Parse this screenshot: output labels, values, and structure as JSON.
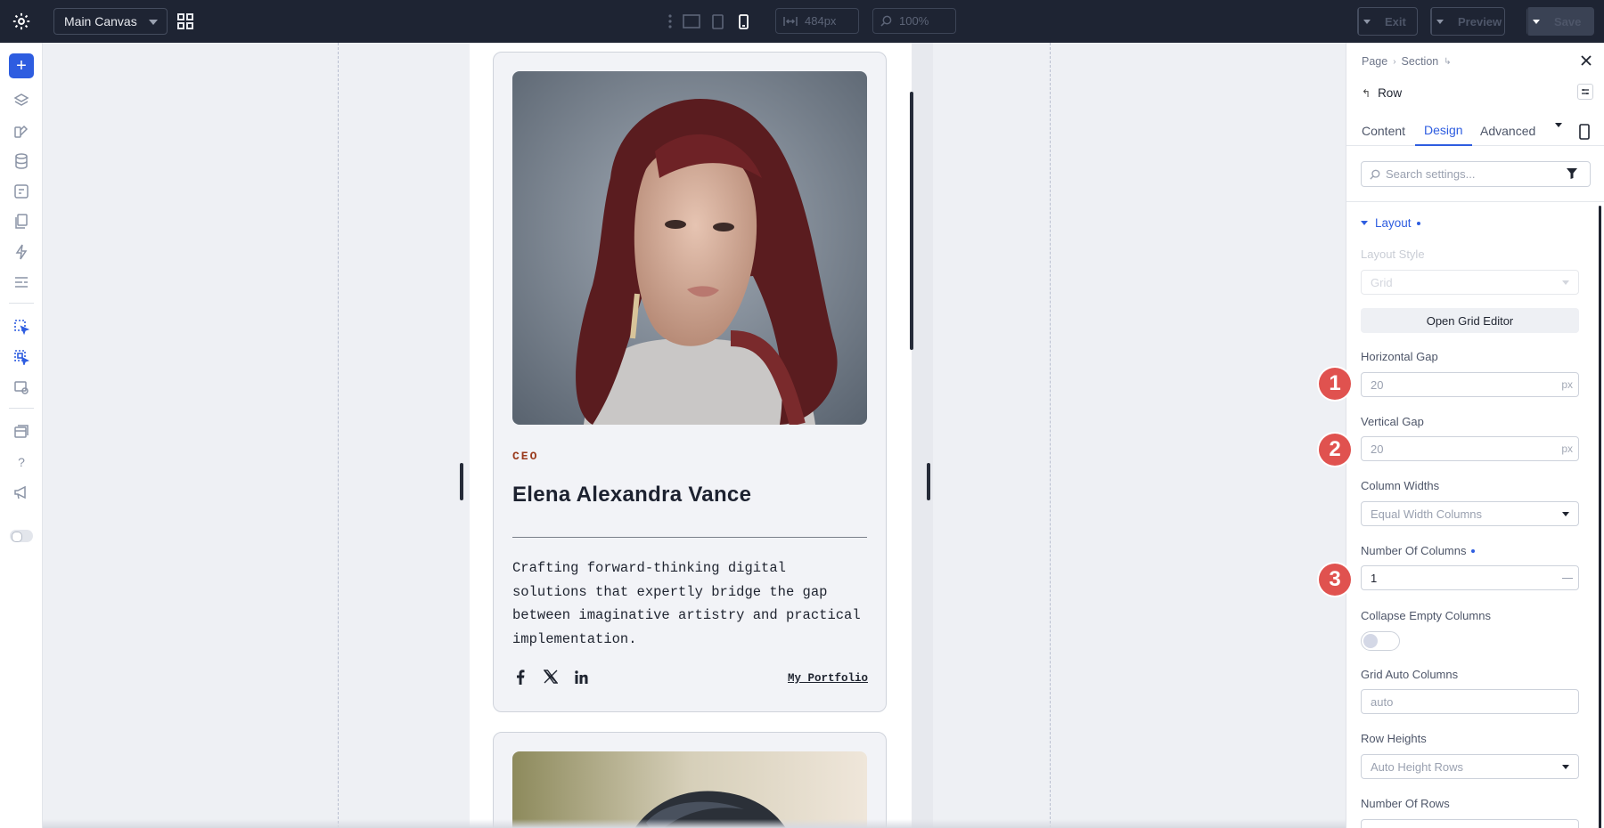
{
  "topbar": {
    "canvas_select": "Main Canvas",
    "width_value": "484px",
    "zoom_value": "100%",
    "exit_label": "Exit",
    "preview_label": "Preview",
    "save_label": "Save"
  },
  "card": {
    "role": "CEO",
    "name": "Elena Alexandra Vance",
    "bio": "Crafting forward-thinking digital solutions that expertly bridge the gap between imaginative artistry and practical implementation.",
    "portfolio_link": "My Portfolio"
  },
  "panel": {
    "breadcrumb": [
      "Page",
      "Section"
    ],
    "element_title": "Row",
    "tabs": [
      "Content",
      "Design",
      "Advanced"
    ],
    "active_tab": "Design",
    "search_placeholder": "Search settings...",
    "section_title": "Layout",
    "layout_style_label": "Layout Style",
    "layout_style_value": "Grid",
    "grid_editor_button": "Open Grid Editor",
    "horizontal_gap_label": "Horizontal Gap",
    "horizontal_gap_placeholder": "20",
    "vertical_gap_label": "Vertical Gap",
    "vertical_gap_placeholder": "20",
    "unit": "px",
    "column_widths_label": "Column Widths",
    "column_widths_value": "Equal Width Columns",
    "number_columns_label": "Number Of Columns",
    "number_columns_value": "1",
    "collapse_label": "Collapse Empty Columns",
    "grid_auto_columns_label": "Grid Auto Columns",
    "grid_auto_columns_placeholder": "auto",
    "row_heights_label": "Row Heights",
    "row_heights_value": "Auto Height Rows",
    "number_rows_label": "Number Of Rows"
  },
  "badges": [
    "1",
    "2",
    "3"
  ],
  "colors": {
    "accent": "#2e5de0",
    "topbar": "#1e2433",
    "badge": "#e0524f",
    "role": "#9a3b1e"
  }
}
